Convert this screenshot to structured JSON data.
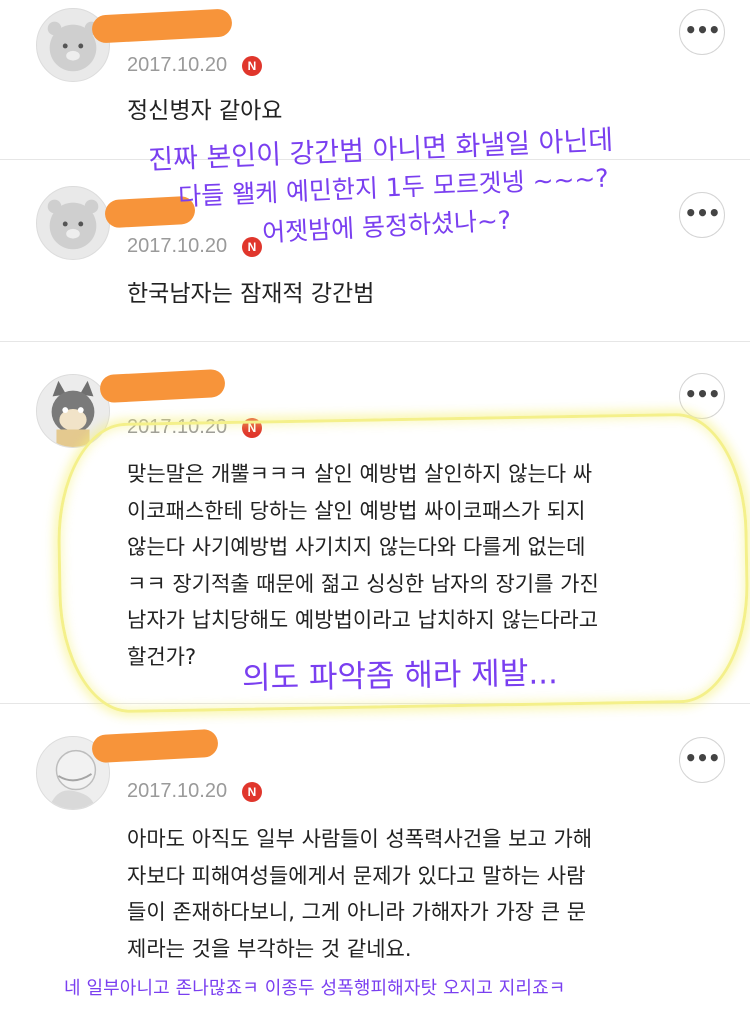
{
  "comments": [
    {
      "date": "2017.10.20",
      "badge": "N",
      "more": "•••",
      "lines": [
        "정신병자 같아요"
      ]
    },
    {
      "date": "2017.10.20",
      "badge": "N",
      "more": "•••",
      "lines": [
        "한국남자는 잠재적 강간범"
      ]
    },
    {
      "date": "2017.10.20",
      "badge": "N",
      "more": "•••",
      "lines": [
        "맞는말은 개뿔ㅋㅋㅋ 살인 예방법 살인하지 않는다 싸",
        "이코패스한테 당하는 살인 예방법  싸이코패스가 되지",
        "않는다 사기예방법 사기치지 않는다와 다를게 없는데",
        "ㅋㅋ 장기적출 때문에 젊고 싱싱한 남자의 장기를 가진",
        "남자가 납치당해도 예방법이라고 납치하지 않는다라고",
        "할건가?"
      ]
    },
    {
      "date": "2017.10.20",
      "badge": "N",
      "more": "•••",
      "lines": [
        "아마도 아직도 일부 사람들이 성폭력사건을 보고 가해",
        "자보다  피해여성들에게서 문제가 있다고 말하는 사람",
        "들이 존재하다보니, 그게 아니라 가해자가 가장 큰 문",
        "제라는 것을 부각하는 것 같네요."
      ]
    }
  ],
  "annotations": {
    "top_line1": "진짜 본인이 강간범 아니면 화낼일 아닌데",
    "top_line2": "다들 왤케 예민한지 1두 모르겟넹 ~~~?",
    "top_line3": "어젯밤에 몽정하셨나~?",
    "middle": "의도 파악좀 해라 제발...",
    "bottom": "네 일부아니고 존나많죠ㅋ 이종두 성폭행피해자탓 오지고 지리죠ㅋ"
  },
  "colors": {
    "annotation_text": "#7a3ff0",
    "name_redaction": "#f7943a",
    "highlight": "#f4f08a",
    "badge": "#e0362c"
  }
}
